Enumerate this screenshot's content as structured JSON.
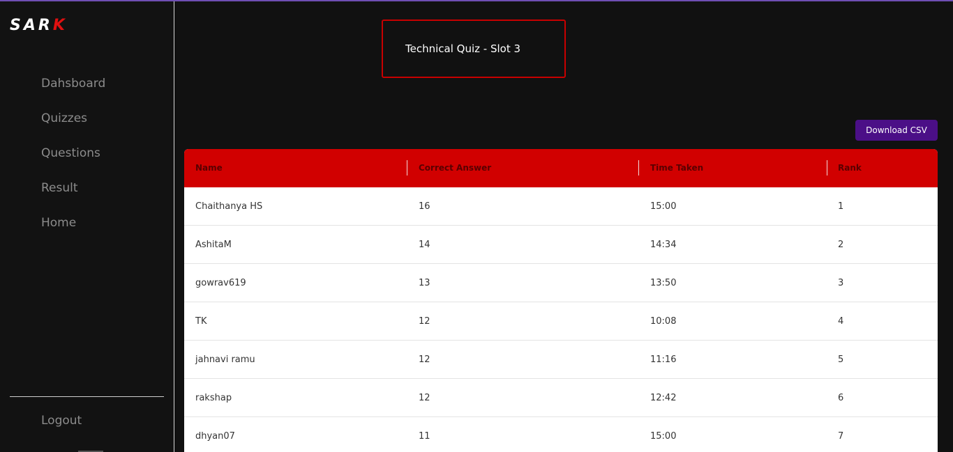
{
  "brand": {
    "logo_main": "SAR",
    "logo_accent": "K"
  },
  "sidebar": {
    "items": [
      {
        "label": "Dahsboard"
      },
      {
        "label": "Quizzes"
      },
      {
        "label": "Questions"
      },
      {
        "label": "Result"
      },
      {
        "label": "Home"
      }
    ],
    "logout_label": "Logout"
  },
  "quiz": {
    "title": "Technical Quiz - Slot 3"
  },
  "toolbar": {
    "download_label": "Download CSV"
  },
  "table": {
    "columns": [
      "Name",
      "Correct Answer",
      "Time Taken",
      "Rank"
    ],
    "rows": [
      {
        "name": "Chaithanya HS",
        "correct": "16",
        "time": "15:00",
        "rank": "1"
      },
      {
        "name": "AshitaM",
        "correct": "14",
        "time": "14:34",
        "rank": "2"
      },
      {
        "name": "gowrav619",
        "correct": "13",
        "time": "13:50",
        "rank": "3"
      },
      {
        "name": "TK",
        "correct": "12",
        "time": "10:08",
        "rank": "4"
      },
      {
        "name": "jahnavi ramu",
        "correct": "12",
        "time": "11:16",
        "rank": "5"
      },
      {
        "name": "rakshap",
        "correct": "12",
        "time": "12:42",
        "rank": "6"
      },
      {
        "name": "dhyan07",
        "correct": "11",
        "time": "15:00",
        "rank": "7"
      }
    ]
  },
  "colors": {
    "accent_red": "#d10000",
    "button_purple": "#4b0f87",
    "background": "#111111"
  }
}
